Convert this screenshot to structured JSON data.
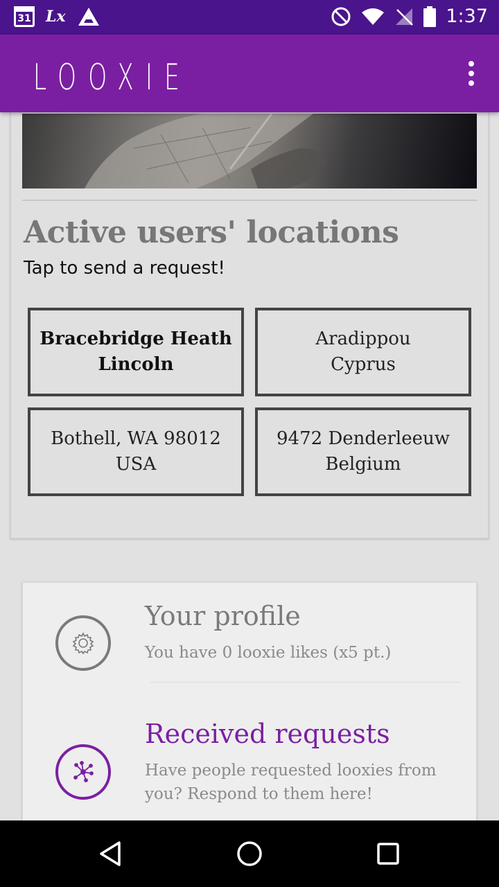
{
  "status_bar": {
    "calendar_day": "31",
    "app_badge": "Lx",
    "time": "1:37",
    "icons": [
      "calendar-icon",
      "looxie-notification-icon",
      "triangle-app-icon",
      "do-not-disturb-icon",
      "wifi-icon",
      "no-signal-icon",
      "battery-icon"
    ]
  },
  "app_bar": {
    "title": "LOOXIE",
    "menu_icon": "overflow-menu-icon"
  },
  "locations_section": {
    "heading": "Active users' locations",
    "subtitle": "Tap to send a request!",
    "tiles": [
      {
        "line1": "Bracebridge Heath",
        "line2": "Lincoln",
        "selected": true
      },
      {
        "line1": "Aradippou",
        "line2": "Cyprus",
        "selected": false
      },
      {
        "line1": "Bothell, WA 98012",
        "line2": "USA",
        "selected": false
      },
      {
        "line1": "9472 Denderleeuw",
        "line2": "Belgium",
        "selected": false
      }
    ]
  },
  "menu": {
    "profile": {
      "title": "Your profile",
      "subtitle": "You have 0 looxie likes (x5 pt.)",
      "icon": "gear-icon"
    },
    "requests": {
      "title": "Received requests",
      "subtitle": "Have people requested looxies from you? Respond to them here!",
      "icon": "network-icon"
    }
  },
  "nav_bar": {
    "icons": [
      "back-icon",
      "home-icon",
      "recents-icon"
    ]
  },
  "colors": {
    "status_bar": "#4a148c",
    "app_bar": "#7b1fa2",
    "accent": "#7b1fa2",
    "background": "#e1e1e1"
  }
}
